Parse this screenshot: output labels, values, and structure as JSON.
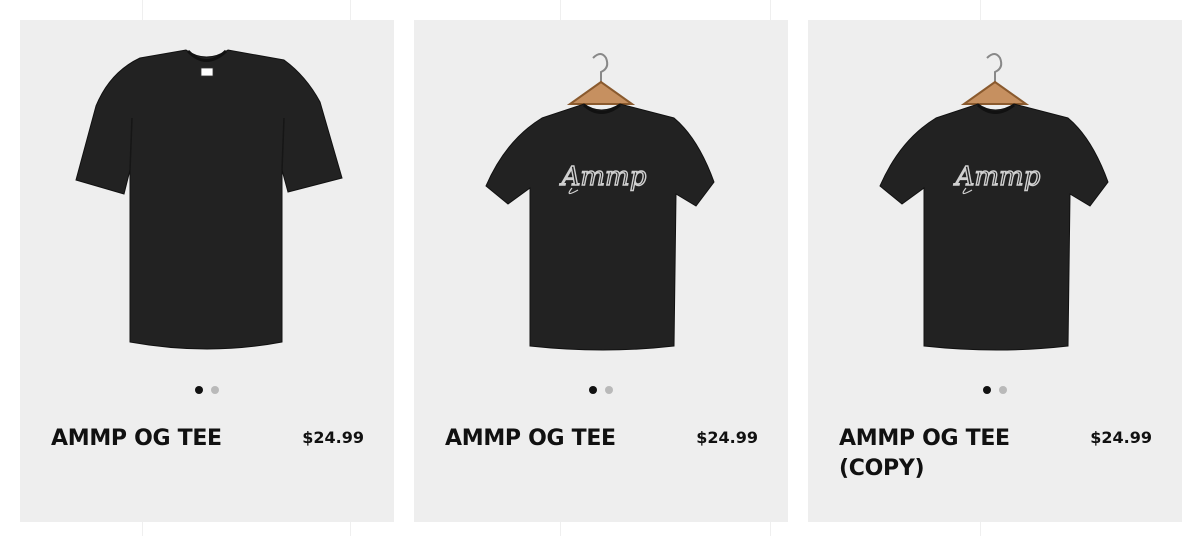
{
  "products": [
    {
      "title": "AMMP OG TEE",
      "price": "$24.99",
      "image": "plain-tee-image",
      "logo_text": "",
      "slides": 2,
      "active_slide": 1
    },
    {
      "title": "AMMP OG TEE",
      "price": "$24.99",
      "image": "hanger-tee-image",
      "logo_text": "Ammp",
      "slides": 2,
      "active_slide": 1
    },
    {
      "title": "AMMP OG TEE (COPY)",
      "price": "$24.99",
      "image": "hanger-tee-image",
      "logo_text": "Ammp",
      "slides": 2,
      "active_slide": 1
    }
  ],
  "colors": {
    "card_bg": "#eeeeee",
    "shirt": "#222222",
    "text": "#111111",
    "dot_active": "#111111",
    "dot_inactive": "#b9b9b9"
  }
}
